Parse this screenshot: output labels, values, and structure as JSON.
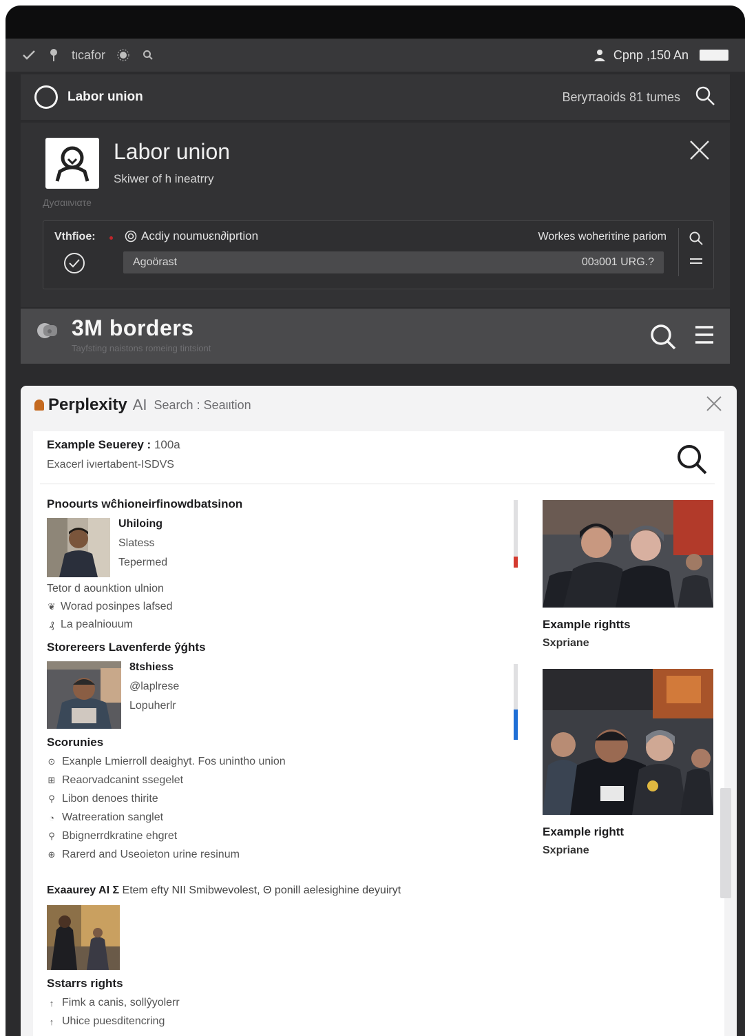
{
  "statusbar": {
    "app_text": "tιcafor",
    "right_text": "Cpnp ,150 An"
  },
  "header": {
    "title": "Labor union",
    "meta": "Beryπaoids 81 tumes"
  },
  "profile": {
    "name": "Labor union",
    "subtitle": "Skiwer of h ineatrry",
    "faint": "Дyσαιινιατe",
    "control": {
      "label": "Vthfioe:",
      "radio_text": "Acdiy noumυɛn∂iprtion",
      "right_text": "Workes woheriτine pariom",
      "field_label": "Agoörast",
      "field_value": "00ɜ001 URG.?"
    }
  },
  "section": {
    "title": "3M borders",
    "subtitle": "Tayfsting naistons romeing tintsiont"
  },
  "perplexity": {
    "brand": "Perplexity",
    "brand_ai": "AI",
    "brand_search": "Search : Seaιιtion",
    "query_label": "Example Seuerey :",
    "query_value": "100a",
    "query_sub": "Exacerl ivιertabent-ISDVS"
  },
  "results": {
    "heading1": "Pnoourts wĉhioneirfinowdbatsinon",
    "person1": {
      "name": "Uhiloing",
      "line2": "Slatess",
      "line3": "Tepermed"
    },
    "lines1": [
      {
        "icon": "",
        "text": "Tetor d aounktion ulnion"
      },
      {
        "icon": "❦",
        "text": "Worad posinpes lafsed"
      },
      {
        "icon": "₰",
        "text": "La pealniouum"
      }
    ],
    "heading2": "Storereers Lavenferde ŷǵhts",
    "person2": {
      "name": "8tshiess",
      "line2": "@laplrese",
      "line3": "Lopuherlr"
    },
    "heading3": "Scorunies",
    "list": [
      {
        "icon": "⊙",
        "text": "Exanple Lmierroll deaighyt. Fos uninthо union"
      },
      {
        "icon": "⊞",
        "text": "Reaorvadcanint ssegelet"
      },
      {
        "icon": "⚲",
        "text": "Libon denoes thirite"
      },
      {
        "icon": "◔",
        "text": "Watreeration sanglet"
      },
      {
        "icon": "⚲",
        "text": "Bbignerrdkratine ehgret"
      },
      {
        "icon": "⊕",
        "text": "Rarerd and Useoieton urine resinum"
      }
    ],
    "heading4_bold": "Exaaurey AI Σ",
    "heading4_rest": "Etem efty NII Smibwevolest, Θ ponill aelesighine deyuiryt",
    "sub_heading": "Sstarrs rights",
    "bottom": [
      {
        "icon": "↑",
        "text": "Fimk a canis, sollŷyolerr"
      },
      {
        "icon": "↑",
        "text": "Uhice puesditencring"
      }
    ]
  },
  "gallery": [
    {
      "cap1": "Example rightts",
      "cap2": "Sxpriane"
    },
    {
      "cap1": "Example rightt",
      "cap2": "Sxpriane"
    }
  ]
}
